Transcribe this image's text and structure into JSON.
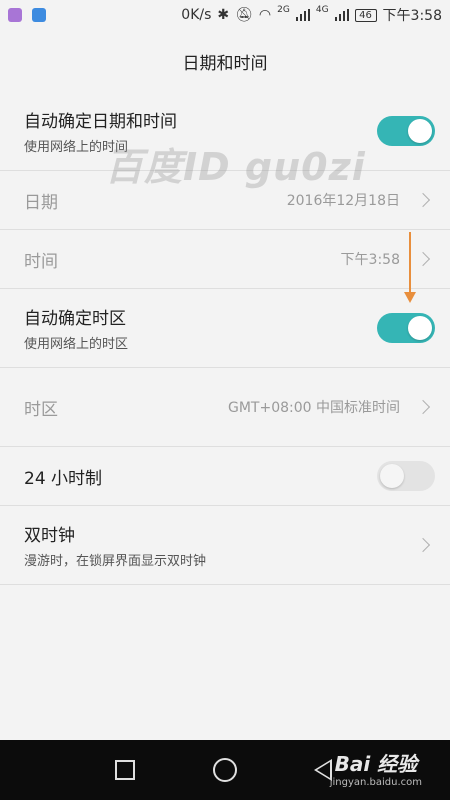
{
  "status_bar": {
    "speed": "0K/s",
    "net_2g": "2G",
    "net_4g": "4G",
    "battery": "46",
    "time": "下午3:58",
    "icons": [
      "bluetooth-icon",
      "mute-icon",
      "wifi-icon",
      "signal-icon"
    ]
  },
  "header": {
    "title": "日期和时间"
  },
  "settings": [
    {
      "title": "自动确定日期和时间",
      "subtitle": "使用网络上的时间",
      "toggle": true
    },
    {
      "title": "日期",
      "value": "2016年12月18日",
      "enabled": false
    },
    {
      "title": "时间",
      "value": "下午3:58",
      "enabled": false
    },
    {
      "title": "自动确定时区",
      "subtitle": "使用网络上的时区",
      "toggle": true
    },
    {
      "title": "时区",
      "value": "GMT+08:00 中国标准时间",
      "enabled": false
    },
    {
      "title": "24 小时制",
      "toggle": false
    },
    {
      "title": "双时钟",
      "subtitle": "漫游时，在锁屏界面显示双时钟"
    }
  ],
  "watermark": "百度ID gu0zi",
  "brand": {
    "logo": "Bai 经验",
    "url": "jingyan.baidu.com"
  },
  "colors": {
    "accent": "#35b5b5",
    "annotation": "#e88e3c"
  }
}
